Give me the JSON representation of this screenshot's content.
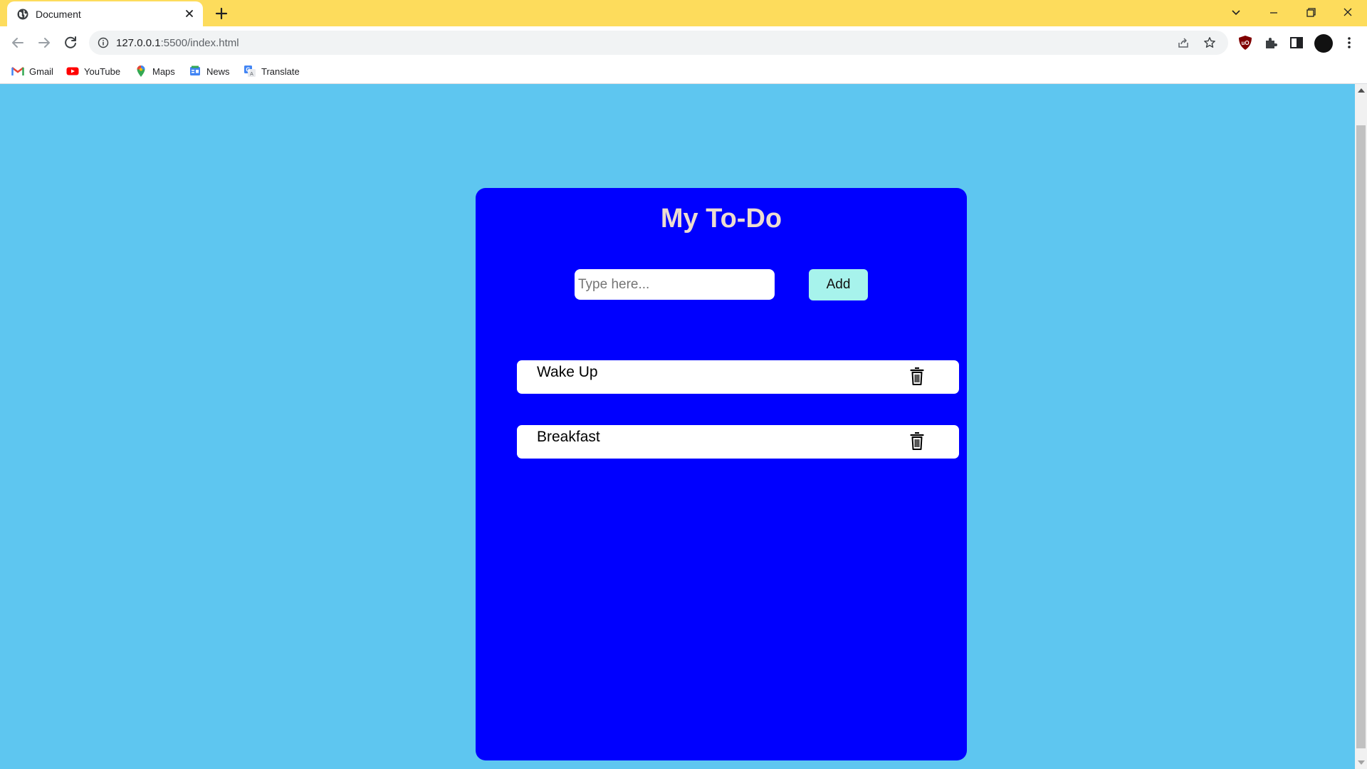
{
  "browser": {
    "tab_title": "Document",
    "url_host": "127.0.0.1",
    "url_path": ":5500/index.html",
    "bookmarks": [
      {
        "label": "Gmail",
        "icon": "gmail-icon"
      },
      {
        "label": "YouTube",
        "icon": "youtube-icon"
      },
      {
        "label": "Maps",
        "icon": "maps-icon"
      },
      {
        "label": "News",
        "icon": "news-icon"
      },
      {
        "label": "Translate",
        "icon": "translate-icon"
      }
    ]
  },
  "app": {
    "title": "My To-Do",
    "input": {
      "placeholder": "Type here...",
      "value": ""
    },
    "add_label": "Add",
    "todos": [
      {
        "text": "Wake Up",
        "icon": "trash-icon"
      },
      {
        "text": "Breakfast",
        "icon": "trash-icon"
      }
    ]
  },
  "colors": {
    "page_background": "#5ec6f0",
    "card_background": "#0000ff",
    "title_color": "#ecdcd0",
    "add_button": "#a7f3ec",
    "tab_strip": "#fddc5c"
  }
}
